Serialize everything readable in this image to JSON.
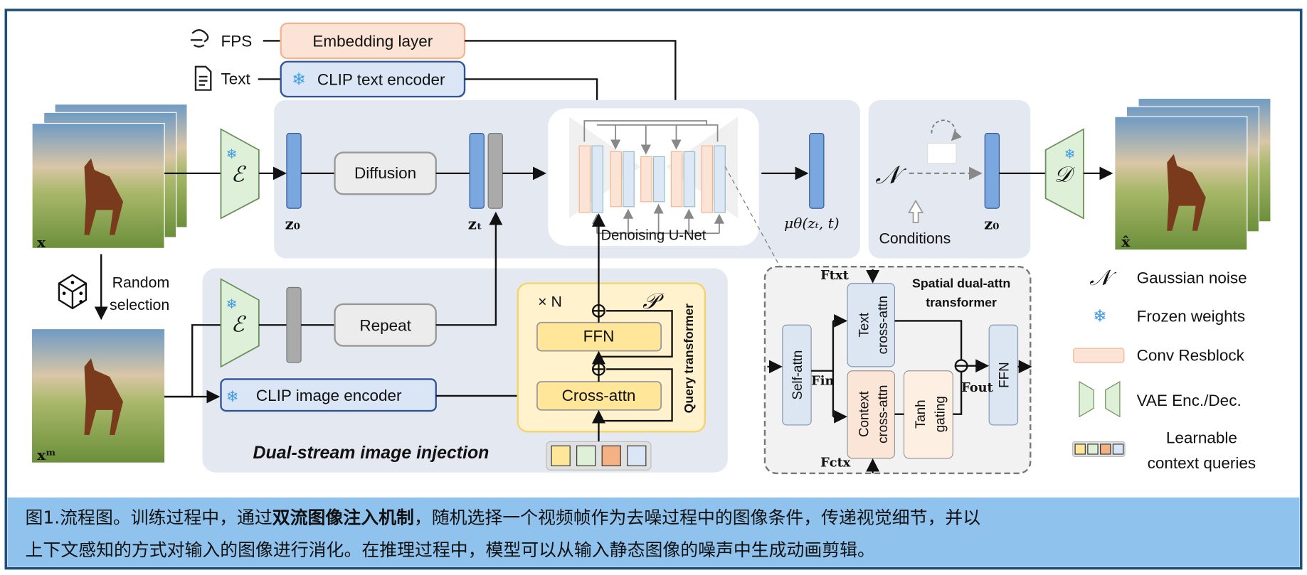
{
  "inputs": {
    "fps": "FPS",
    "text": "Text"
  },
  "modules": {
    "embedding_layer": "Embedding layer",
    "clip_text_encoder": "CLIP text encoder",
    "diffusion": "Diffusion",
    "denoising_unet": "Denoising U-Net",
    "repeat": "Repeat",
    "clip_image_encoder": "CLIP image encoder",
    "ffn": "FFN",
    "cross_attn": "Cross-attn",
    "query_transformer": "Query transformer",
    "times_n": "× N",
    "p_symbol": "𝒫",
    "dual_stream": "Dual-stream image injection",
    "conditions": "Conditions",
    "random_selection": [
      "Random",
      "selection"
    ]
  },
  "symbols": {
    "encoder": "ℰ",
    "decoder": "𝒟",
    "noise": "𝒩",
    "z0": "z₀",
    "zt": "zₜ",
    "mu": "μθ(zₜ, t)",
    "x": "x",
    "xm": "xᵐ",
    "xhat": "x̂"
  },
  "spatial": {
    "title": [
      "Spatial dual-attn",
      "transformer"
    ],
    "self_attn": "Self-attn",
    "text_cross_attn": [
      "Text",
      "cross-attn"
    ],
    "context_cross_attn": [
      "Context",
      "cross-attn"
    ],
    "tanh_gating": [
      "Tanh",
      "gating"
    ],
    "ffn": "FFN",
    "f_txt": "Ftxt",
    "f_in": "Fin",
    "f_out": "Fout",
    "f_ctx": "Fctx"
  },
  "legend": {
    "gaussian_noise": "Gaussian noise",
    "frozen_weights": "Frozen weights",
    "conv_resblock": "Conv Resblock",
    "vae": "VAE Enc./Dec.",
    "learnable": [
      "Learnable",
      "context queries"
    ]
  },
  "caption": {
    "line1_a": "图1.流程图。训练过程中，通过",
    "line1_bold": "双流图像注入机制",
    "line1_b": "，随机选择一个视频帧作为去噪过程中的图像条件，传递视觉细节，并以",
    "line2": "上下文感知的方式对输入的图像进行消化。在推理过程中，模型可以从输入静态图像的噪声中生成动画剪辑。"
  },
  "colors": {
    "frame": "#1f4e79",
    "caption_bg": "#8fc3ee",
    "panel": "#e4e8f0",
    "snowflake": "#3d9be9"
  }
}
